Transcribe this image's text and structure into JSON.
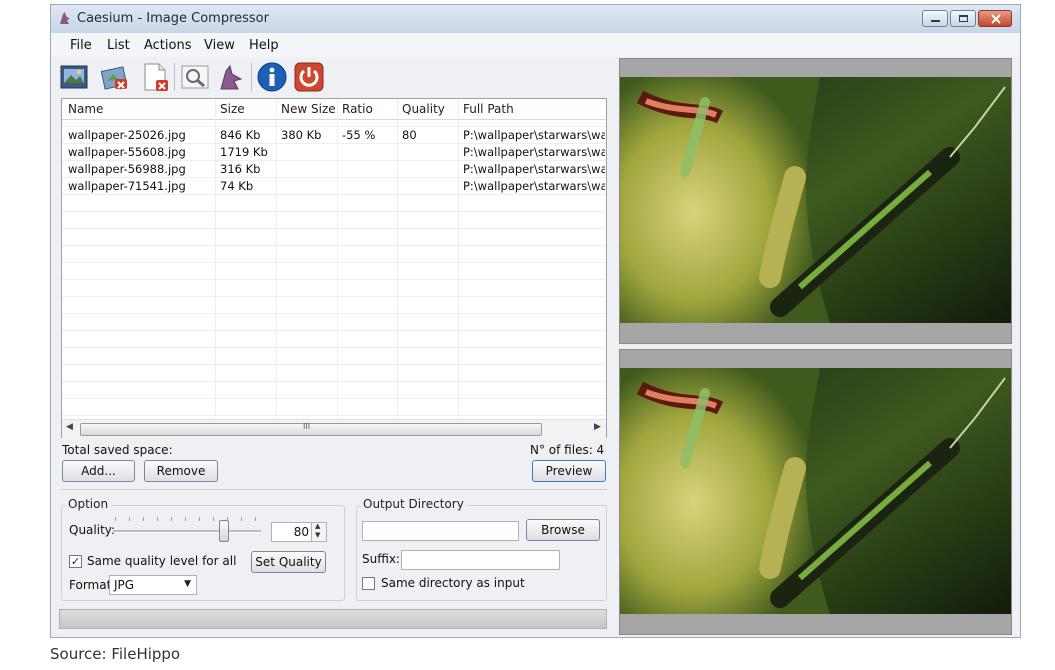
{
  "window": {
    "title": "Caesium - Image Compressor"
  },
  "menu": [
    "File",
    "List",
    "Actions",
    "View",
    "Help"
  ],
  "toolbar_icons": [
    "open-images-icon",
    "remove-items-icon",
    "clear-list-icon",
    "preview-icon",
    "compress-icon",
    "info-icon",
    "exit-icon"
  ],
  "table": {
    "columns": [
      "Name",
      "Size",
      "New Size",
      "Ratio",
      "Quality",
      "Full Path"
    ],
    "rows": [
      {
        "name": "wallpaper-25026.jpg",
        "size": "846 Kb",
        "new_size": "380 Kb",
        "ratio": "-55 %",
        "quality": "80",
        "path": "P:\\wallpaper\\starwars\\wallpa"
      },
      {
        "name": "wallpaper-55608.jpg",
        "size": "1719 Kb",
        "new_size": "",
        "ratio": "",
        "quality": "",
        "path": "P:\\wallpaper\\starwars\\wallpa"
      },
      {
        "name": "wallpaper-56988.jpg",
        "size": "316 Kb",
        "new_size": "",
        "ratio": "",
        "quality": "",
        "path": "P:\\wallpaper\\starwars\\wallpa"
      },
      {
        "name": "wallpaper-71541.jpg",
        "size": "74 Kb",
        "new_size": "",
        "ratio": "",
        "quality": "",
        "path": "P:\\wallpaper\\starwars\\wallpa"
      }
    ],
    "scroll_grip": "III"
  },
  "total_saved_label": "Total saved space:",
  "file_count_label": "N° of files: 4",
  "buttons": {
    "add": "Add...",
    "remove": "Remove",
    "preview": "Preview",
    "set_quality": "Set Quality",
    "browse": "Browse"
  },
  "option": {
    "group_label": "Option",
    "quality_label": "Quality:",
    "quality_value": "80",
    "same_quality_label": "Same quality level for all",
    "same_quality_checked": true,
    "format_label": "Format:",
    "format_value": "JPG"
  },
  "output": {
    "group_label": "Output Directory",
    "directory_value": "",
    "suffix_label": "Suffix:",
    "suffix_value": "",
    "same_dir_label": "Same directory as input",
    "same_dir_checked": false
  },
  "source_caption": "Source: FileHippo"
}
